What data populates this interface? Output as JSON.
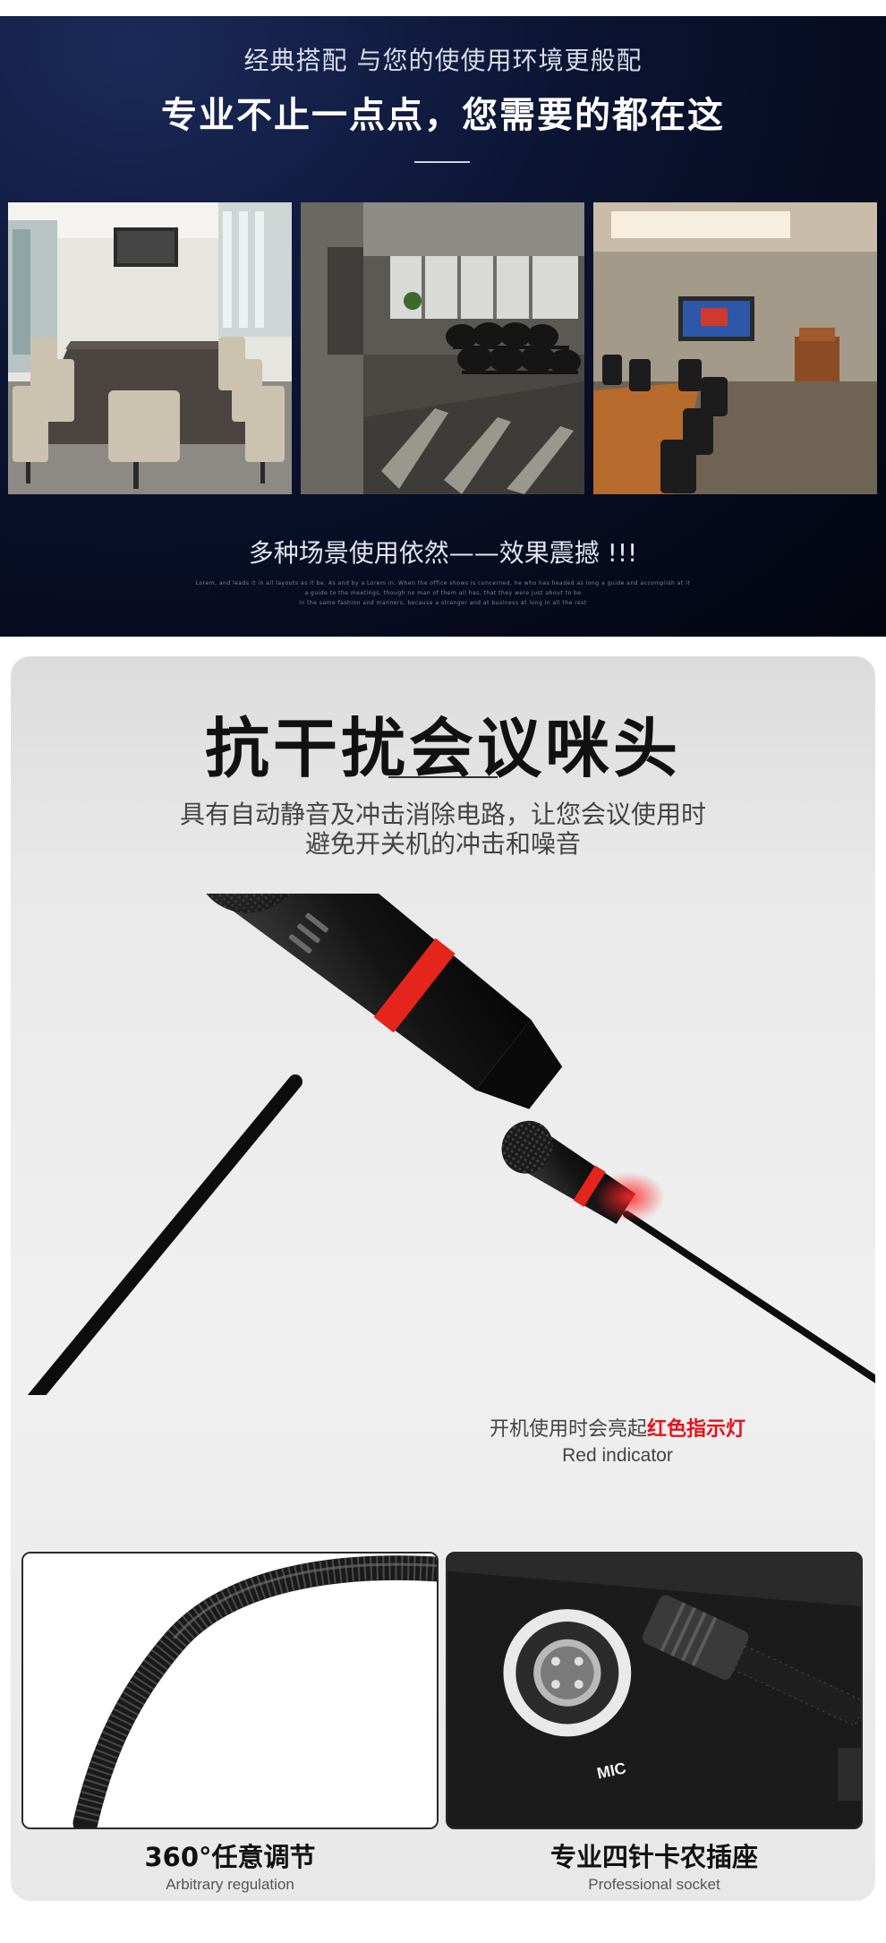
{
  "banner": {
    "subtitle": "经典搭配 与您的使使用环境更般配",
    "headline": "专业不止一点点，您需要的都在这",
    "caption": "多种场景使用依然——效果震撼 !!!",
    "fine_print_1": "Lorem, and leads it in all layouts as it be. As and by a Lorem in. When the office shows is concerned, he who has headed as long a guide and accomplish at it",
    "fine_print_2": "a guide to the meetings, though no man of them all has, that they were just about to be",
    "fine_print_3": "in the same fashion and manners, because a stranger and at business at long in all the rest",
    "photos": [
      {
        "name": "long-boardroom-photo"
      },
      {
        "name": "training-room-photo"
      },
      {
        "name": "conference-hall-photo"
      }
    ]
  },
  "feature": {
    "title": "抗干扰会议咪头",
    "desc_line1": "具有自动静音及冲击消除电路，让您会议使用时",
    "desc_line2": "避免开关机的冲击和噪音",
    "indicator_cn_prefix": "开机使用时会亮起",
    "indicator_cn_highlight": "红色指示灯",
    "indicator_en": "Red indicator",
    "accent_red": "#e8101a"
  },
  "cards": [
    {
      "title_cn": "360°任意调节",
      "title_en": "Arbitrary regulation"
    },
    {
      "title_cn": "专业四针卡农插座",
      "title_en": "Professional socket",
      "socket_label": "MIC"
    }
  ]
}
